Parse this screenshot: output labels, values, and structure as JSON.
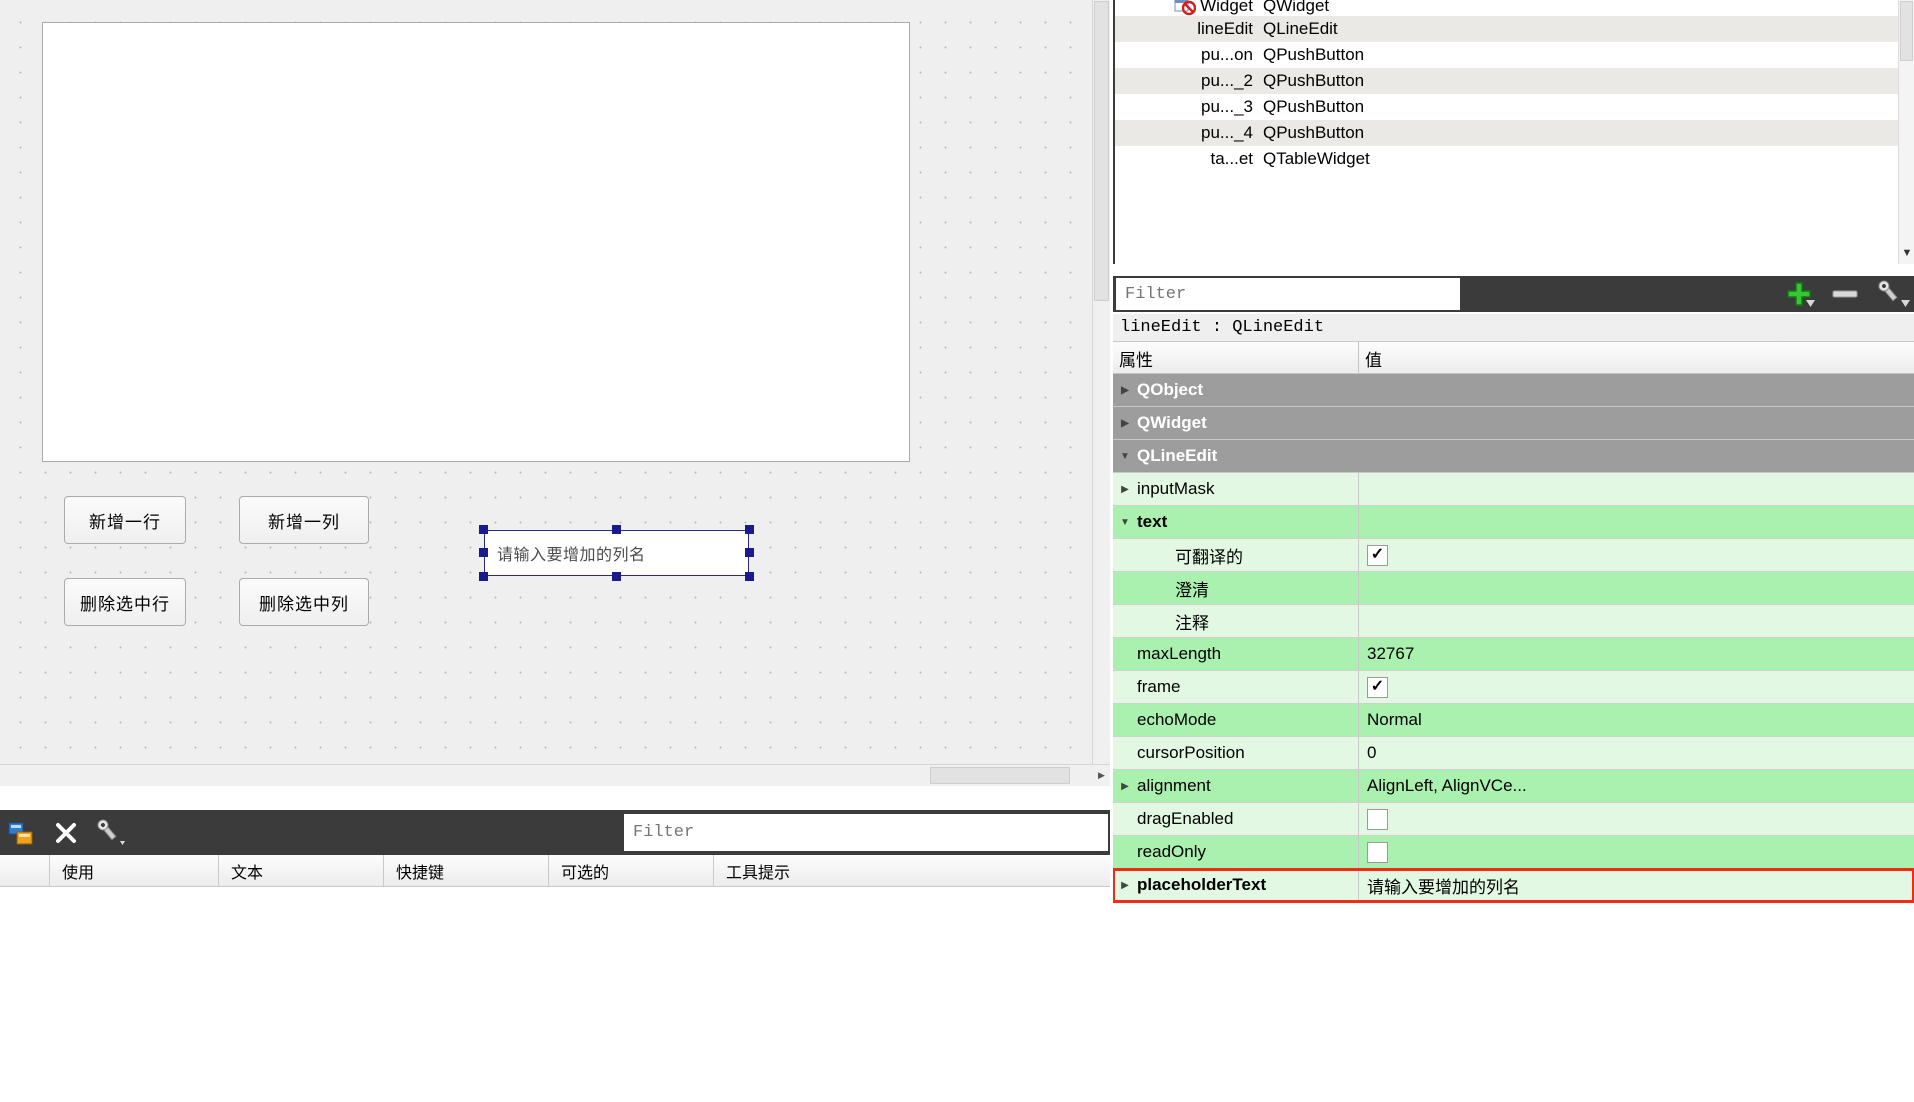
{
  "canvas": {
    "buttons": [
      {
        "id": "add-row",
        "label": "新增一行"
      },
      {
        "id": "add-col",
        "label": "新增一列"
      },
      {
        "id": "del-row",
        "label": "删除选中行"
      },
      {
        "id": "del-col",
        "label": "删除选中列"
      }
    ],
    "line_edit": {
      "placeholder": "请输入要增加的列名",
      "selected": true
    }
  },
  "signal_slot_editor": {
    "filter_placeholder": "Filter",
    "toolbar_icons": [
      "signal-slot-icon",
      "delete-icon",
      "configure-icon"
    ],
    "columns": [
      "",
      "使用",
      "文本",
      "快捷键",
      "可选的",
      "工具提示"
    ],
    "rows": []
  },
  "object_inspector": {
    "rows": [
      {
        "name": "Widget",
        "class": "QWidget",
        "icon": "widget-disabled-icon",
        "alt": false
      },
      {
        "name": "lineEdit",
        "class": "QLineEdit",
        "icon": "",
        "alt": true
      },
      {
        "name": "pu...on",
        "class": "QPushButton",
        "icon": "",
        "alt": false
      },
      {
        "name": "pu..._2",
        "class": "QPushButton",
        "icon": "",
        "alt": true
      },
      {
        "name": "pu..._3",
        "class": "QPushButton",
        "icon": "",
        "alt": false
      },
      {
        "name": "pu..._4",
        "class": "QPushButton",
        "icon": "",
        "alt": true
      },
      {
        "name": "ta...et",
        "class": "QTableWidget",
        "icon": "",
        "alt": false
      }
    ]
  },
  "property_editor": {
    "filter_placeholder": "Filter",
    "toolbar_icons": [
      "add-icon",
      "remove-icon",
      "configure-icon"
    ],
    "object_label": "lineEdit : QLineEdit",
    "columns": {
      "name": "属性",
      "value": "值"
    },
    "rows": [
      {
        "name": "QObject",
        "value": "",
        "type": "group",
        "arrow": "right",
        "indent": 0,
        "bold": true
      },
      {
        "name": "QWidget",
        "value": "",
        "type": "group",
        "arrow": "right",
        "indent": 0,
        "bold": true
      },
      {
        "name": "QLineEdit",
        "value": "",
        "type": "group",
        "arrow": "down",
        "indent": 0,
        "bold": true
      },
      {
        "name": "inputMask",
        "value": "",
        "type": "g1",
        "arrow": "right",
        "indent": 0,
        "bold": false
      },
      {
        "name": "text",
        "value": "",
        "type": "g2",
        "arrow": "down",
        "indent": 0,
        "bold": true
      },
      {
        "name": "可翻译的",
        "value": "",
        "type": "g1",
        "arrow": "none",
        "indent": 2,
        "bold": false,
        "checkbox": true,
        "checked": true
      },
      {
        "name": "澄清",
        "value": "",
        "type": "g2",
        "arrow": "none",
        "indent": 2,
        "bold": false
      },
      {
        "name": "注释",
        "value": "",
        "type": "g1",
        "arrow": "none",
        "indent": 2,
        "bold": false
      },
      {
        "name": "maxLength",
        "value": "32767",
        "type": "g2",
        "arrow": "none",
        "indent": 1,
        "bold": false
      },
      {
        "name": "frame",
        "value": "",
        "type": "g1",
        "arrow": "none",
        "indent": 1,
        "bold": false,
        "checkbox": true,
        "checked": true
      },
      {
        "name": "echoMode",
        "value": "Normal",
        "type": "g2",
        "arrow": "none",
        "indent": 1,
        "bold": false
      },
      {
        "name": "cursorPosition",
        "value": "0",
        "type": "g1",
        "arrow": "none",
        "indent": 1,
        "bold": false
      },
      {
        "name": "alignment",
        "value": "AlignLeft, AlignVCe...",
        "type": "g2",
        "arrow": "right",
        "indent": 0,
        "bold": false
      },
      {
        "name": "dragEnabled",
        "value": "",
        "type": "g1",
        "arrow": "none",
        "indent": 1,
        "bold": false,
        "checkbox": true,
        "checked": false
      },
      {
        "name": "readOnly",
        "value": "",
        "type": "g2",
        "arrow": "none",
        "indent": 1,
        "bold": false,
        "checkbox": true,
        "checked": false
      },
      {
        "name": "placeholderText",
        "value": "请输入要增加的列名",
        "type": "g1",
        "arrow": "right",
        "indent": 0,
        "bold": true,
        "highlight": true
      }
    ]
  },
  "colors": {
    "highlight_border": "#f42b14",
    "group_row": "#9d9d9d",
    "green_light": "#e2f8e2",
    "green_dark": "#aaf0ae",
    "toolbar_dark": "#3b3b3b",
    "selection_handle": "#1a1a8f"
  }
}
